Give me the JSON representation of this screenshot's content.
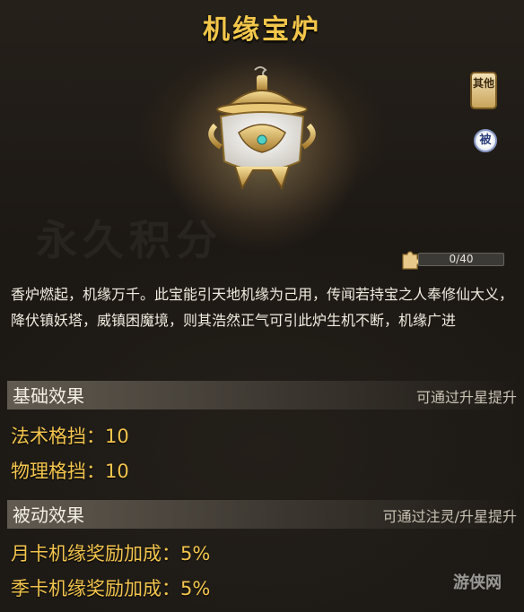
{
  "title": "机缘宝炉",
  "tags": {
    "other": "其他",
    "passive": "被"
  },
  "progress": {
    "text": "0/40",
    "current": 0,
    "max": 40
  },
  "description": "香炉燃起，机缘万千。此宝能引天地机缘为己用，传闻若持宝之人奉修仙大义，降伏镇妖塔，威镇困魔境，则其浩然正气可引此炉生机不断，机缘广进",
  "basic": {
    "heading": "基础效果",
    "hint": "可通过升星提升",
    "stats": [
      "法术格挡：10",
      "物理格挡：10"
    ]
  },
  "passive_effects": {
    "heading": "被动效果",
    "hint": "可通过注灵/升星提升",
    "stats": [
      "月卡机缘奖励加成：5%",
      "季卡机缘奖励加成：5%"
    ]
  },
  "watermark": "游侠网"
}
